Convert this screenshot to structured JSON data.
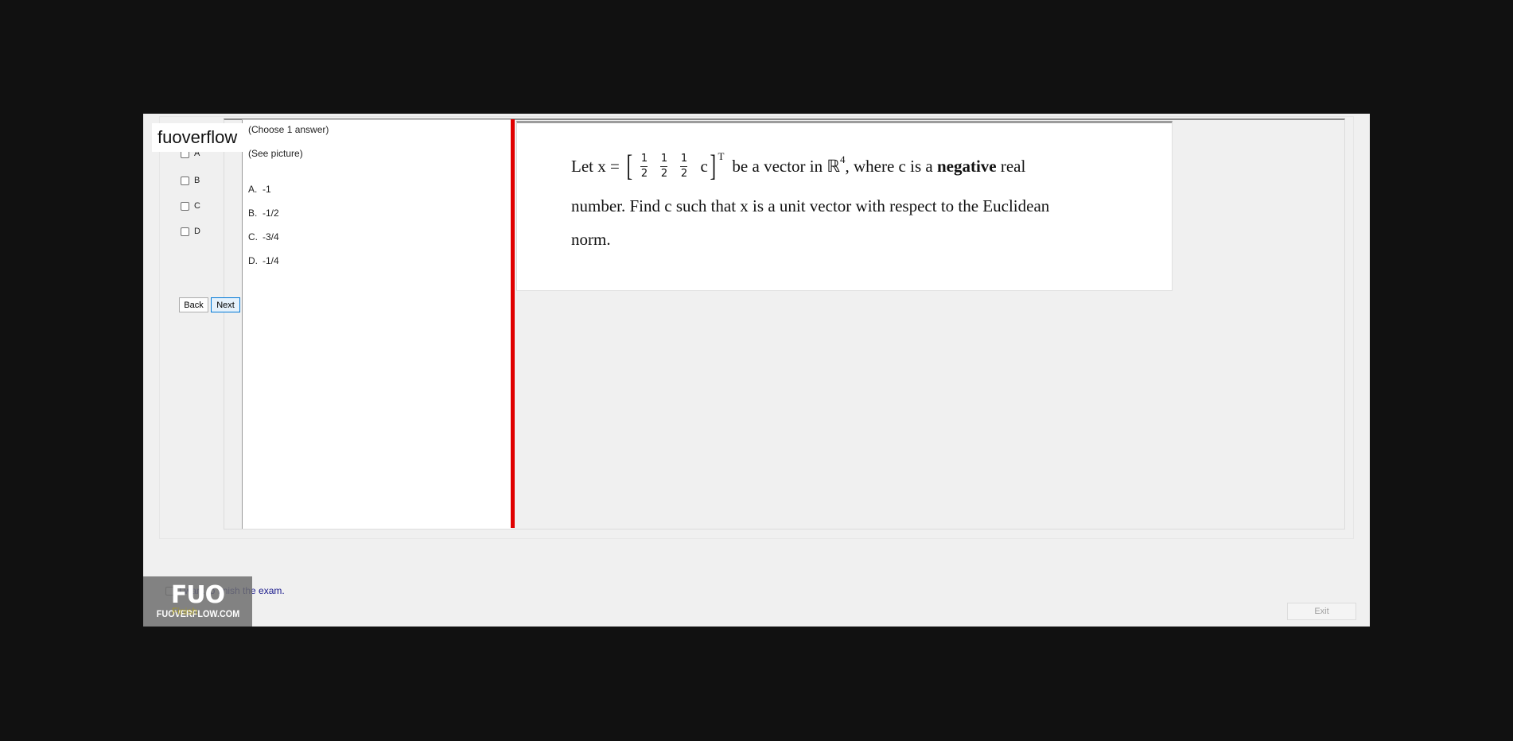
{
  "watermark": {
    "brand_text": "fuoverflow",
    "logo_text": "FUO",
    "logo_domain": "FUOVERFLOW.COM"
  },
  "answers": {
    "options": [
      {
        "label": "A"
      },
      {
        "label": "B"
      },
      {
        "label": "C"
      },
      {
        "label": "D"
      }
    ]
  },
  "nav": {
    "back_label": "Back",
    "next_label": "Next"
  },
  "question": {
    "instruction": "(Choose 1 answer)",
    "subtitle": "(See picture)",
    "choices": [
      {
        "letter": "A.",
        "value": "-1"
      },
      {
        "letter": "B.",
        "value": "-1/2"
      },
      {
        "letter": "C.",
        "value": "-3/4"
      },
      {
        "letter": "D.",
        "value": "-1/4"
      }
    ]
  },
  "image": {
    "let_text": "Let x =",
    "matrix_num": "1",
    "matrix_den": "2",
    "matrix_c": "c",
    "transpose": "T",
    "after_matrix": "be a vector in ℝ",
    "dim": "4",
    "line1_rest_a": ", where c is a ",
    "line1_bold": "negative",
    "line1_rest_b": " real",
    "line2": "number. Find c such that x is a unit vector with respect to the Euclidean",
    "line3": "norm."
  },
  "footer": {
    "finish_text": "I want to finish the exam.",
    "finish_button_label": "Finish",
    "exit_label": "Exit"
  }
}
